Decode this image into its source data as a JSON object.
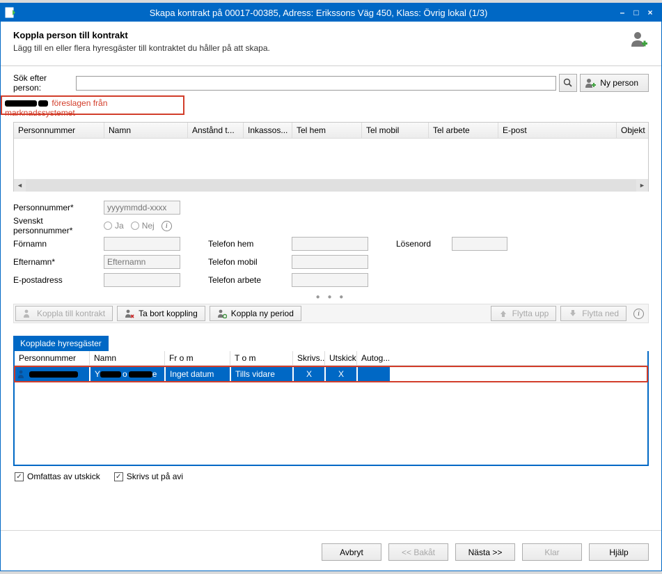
{
  "window": {
    "title": "Skapa kontrakt på 00017-00385, Adress: Erikssons Väg 450, Klass: Övrig lokal (1/3)"
  },
  "header": {
    "title": "Koppla person till kontrakt",
    "subtitle": "Lägg till en eller flera hyresgäster till kontraktet du håller på att skapa."
  },
  "search": {
    "label": "Sök efter person:",
    "value": "",
    "new_person_label": "Ny person",
    "suggestion_text": " föreslagen från marknadssystemet"
  },
  "grid1_headers": [
    "Personnummer",
    "Namn",
    "Anstånd t...",
    "Inkassos...",
    "Tel hem",
    "Tel mobil",
    "Tel arbete",
    "E-post",
    "Objekt"
  ],
  "form": {
    "personnummer_label": "Personnummer*",
    "personnummer_placeholder": "yyyymmdd-xxxx",
    "svenskt_label": "Svenskt personnummer*",
    "ja": "Ja",
    "nej": "Nej",
    "fornamn_label": "Förnamn",
    "efternamn_label": "Efternamn*",
    "efternamn_placeholder": "Efternamn",
    "epost_label": "E-postadress",
    "tel_hem_label": "Telefon hem",
    "tel_mobil_label": "Telefon mobil",
    "tel_arbete_label": "Telefon arbete",
    "losenord_label": "Lösenord"
  },
  "toolbar": {
    "koppla_kontrakt": "Koppla till kontrakt",
    "ta_bort": "Ta bort koppling",
    "koppla_ny": "Koppla ny period",
    "flytta_upp": "Flytta upp",
    "flytta_ned": "Flytta ned"
  },
  "tab": {
    "label": "Kopplade hyresgäster"
  },
  "grid2_headers": [
    "Personnummer",
    "Namn",
    "Fr o m",
    "T o m",
    "Skrivs...",
    "Utskick",
    "Autog..."
  ],
  "grid2_row": {
    "from": "Inget datum",
    "tom": "Tills vidare",
    "skrivs": "X",
    "utskick": "X",
    "autog": ""
  },
  "checks": {
    "omfattas": "Omfattas av utskick",
    "skrivs": "Skrivs ut på avi"
  },
  "footer": {
    "avbryt": "Avbryt",
    "bakat": "<< Bakåt",
    "nasta": "Nästa >>",
    "klar": "Klar",
    "hjalp": "Hjälp"
  }
}
